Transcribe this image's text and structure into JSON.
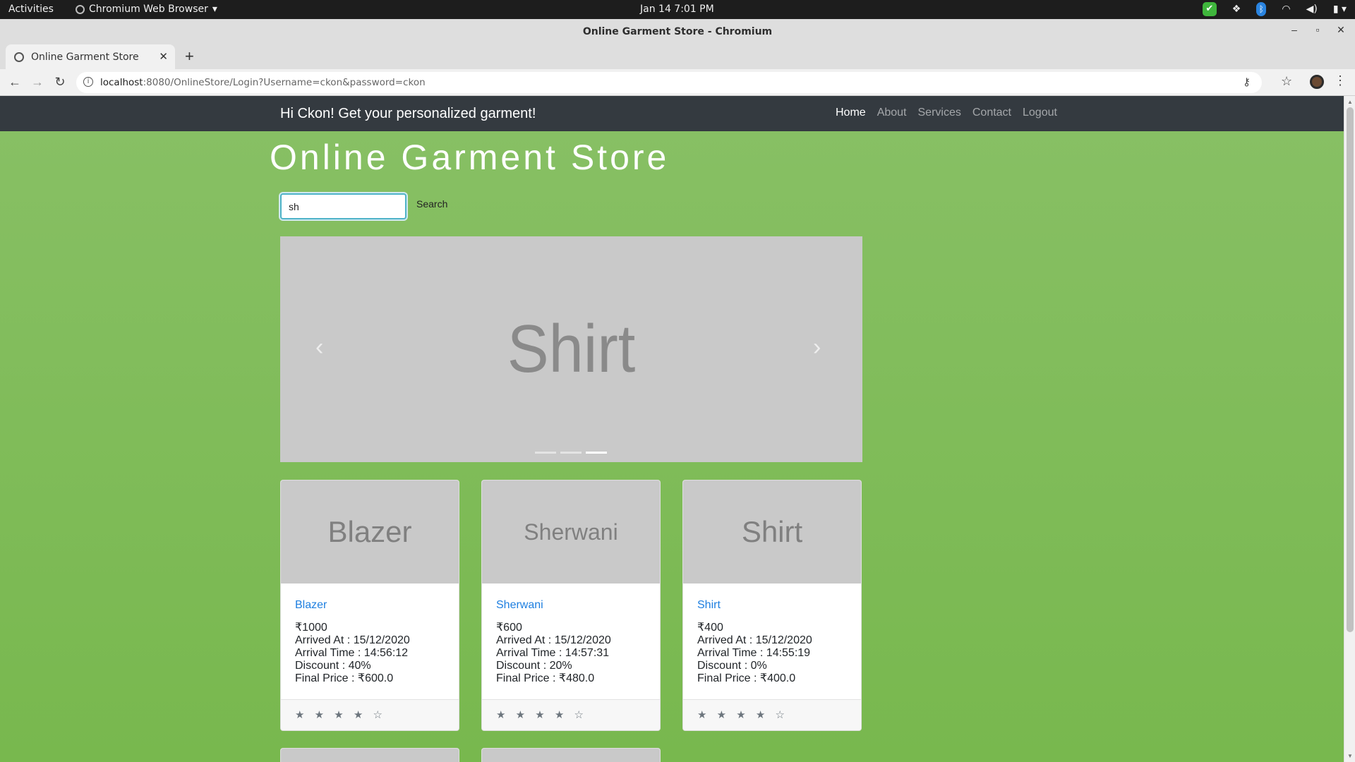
{
  "system": {
    "activities": "Activities",
    "app_menu": "Chromium Web Browser",
    "clock": "Jan 14  7:01 PM"
  },
  "window": {
    "title": "Online Garment Store - Chromium"
  },
  "tab": {
    "title": "Online Garment Store"
  },
  "address": {
    "host": "localhost",
    "rest": ":8080/OnlineStore/Login?Username=ckon&password=ckon"
  },
  "nav": {
    "greeting": "Hi Ckon! Get your personalized garment!",
    "links": [
      "Home",
      "About",
      "Services",
      "Contact",
      "Logout"
    ],
    "active": "Home"
  },
  "page": {
    "title": "Online Garment Store"
  },
  "search": {
    "value": "sh",
    "button": "Search"
  },
  "carousel": {
    "slide_label": "Shirt",
    "prev_glyph": "‹",
    "next_glyph": "›",
    "active_indicator": 3,
    "indicator_count": 3
  },
  "products": [
    {
      "thumb": "Blazer",
      "name": "Blazer",
      "price": "₹1000",
      "arrived": "Arrived At : 15/12/2020",
      "time": "Arrival Time : 14:56:12",
      "discount": "Discount : 40%",
      "final": "Final Price : ₹600.0",
      "rating": "★ ★ ★ ★ ☆"
    },
    {
      "thumb": "Sherwani",
      "name": "Sherwani",
      "price": "₹600",
      "arrived": "Arrived At : 15/12/2020",
      "time": "Arrival Time : 14:57:31",
      "discount": "Discount : 20%",
      "final": "Final Price : ₹480.0",
      "rating": "★ ★ ★ ★ ☆"
    },
    {
      "thumb": "Shirt",
      "name": "Shirt",
      "price": "₹400",
      "arrived": "Arrived At : 15/12/2020",
      "time": "Arrival Time : 14:55:19",
      "discount": "Discount : 0%",
      "final": "Final Price : ₹400.0",
      "rating": "★ ★ ★ ★ ☆"
    }
  ],
  "colors": {
    "navbar": "#343a40",
    "page_bg": "#7dbd57",
    "link": "#1e7fe0"
  }
}
